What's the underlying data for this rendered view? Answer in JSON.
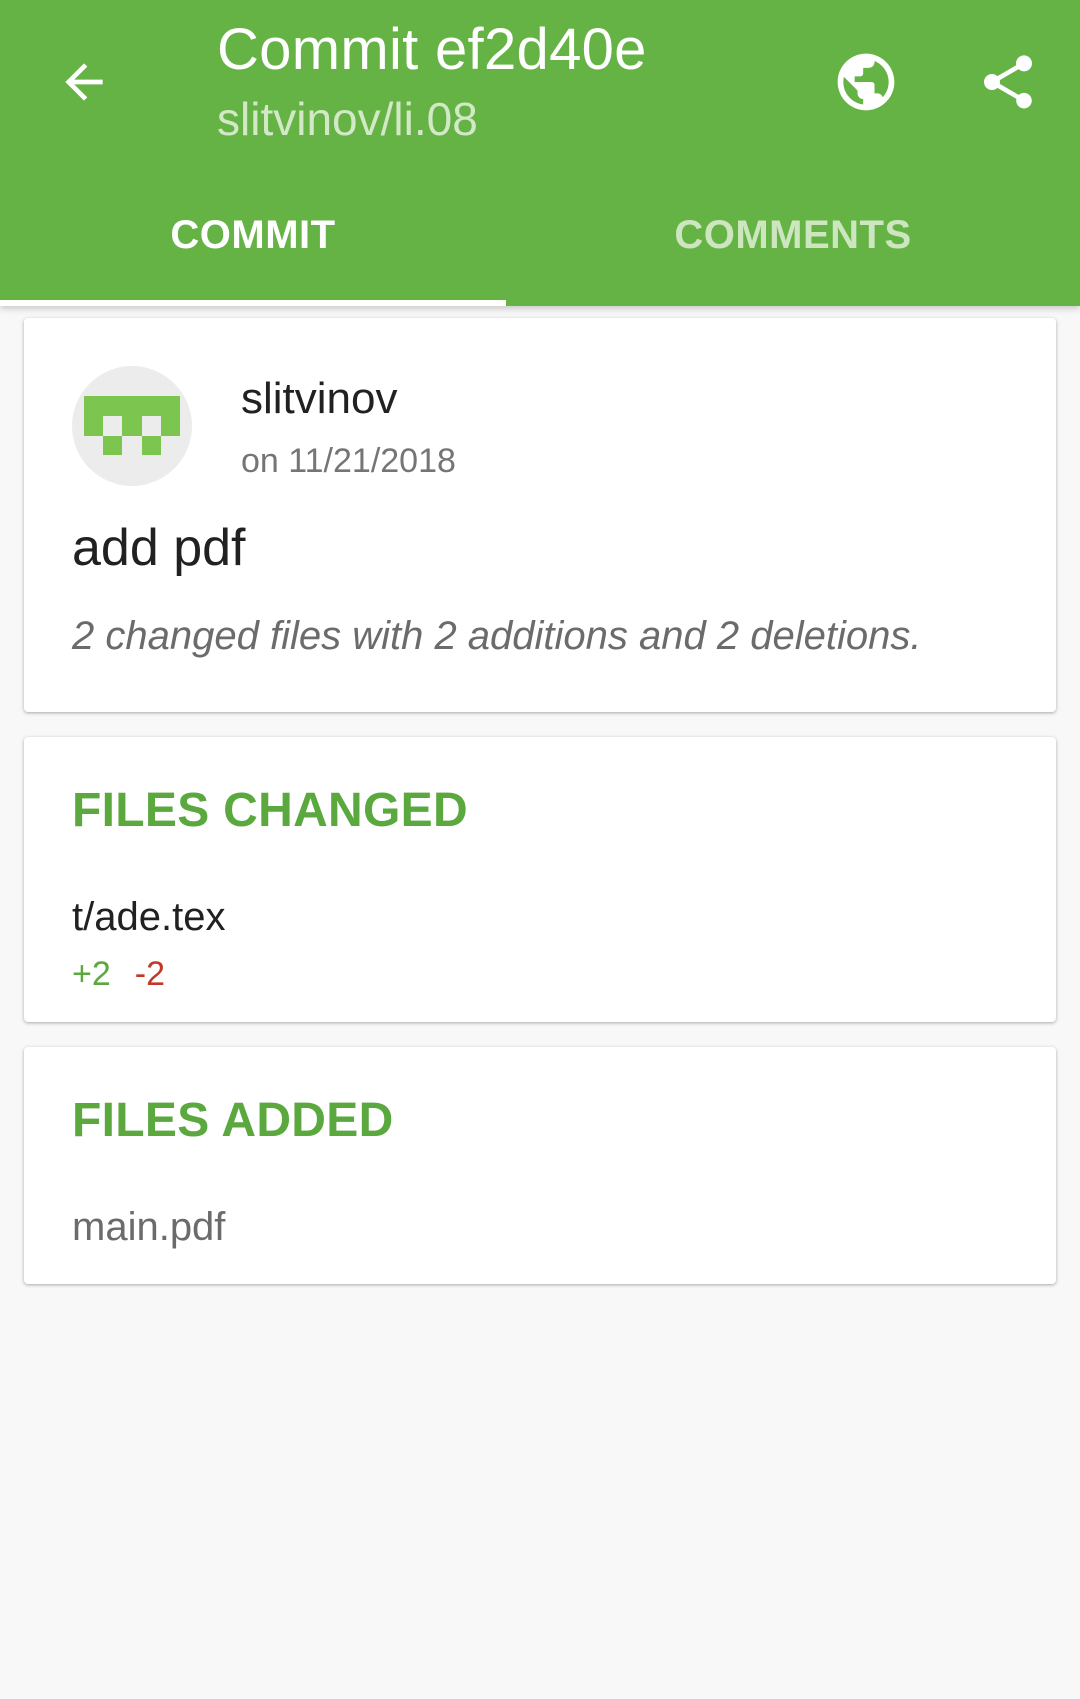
{
  "appbar": {
    "title": "Commit ef2d40e",
    "subtitle": "slitvinov/li.08",
    "background_color": "#65b345",
    "icons": [
      "arrow-back-icon",
      "globe-icon",
      "share-icon"
    ]
  },
  "tabs": [
    {
      "label": "COMMIT",
      "selected": true
    },
    {
      "label": "COMMENTS",
      "selected": false
    }
  ],
  "commit": {
    "author": "slitvinov",
    "date": "on 11/21/2018",
    "message": "add pdf",
    "summary": "2 changed files with 2 additions and 2 deletions."
  },
  "files_changed": {
    "title": "FILES CHANGED",
    "files": [
      {
        "name": "t/ade.tex",
        "additions": "+2",
        "deletions": "-2"
      }
    ]
  },
  "files_added": {
    "title": "FILES ADDED",
    "files": [
      {
        "name": "main.pdf"
      }
    ]
  },
  "colors": {
    "accent": "#65b345",
    "section_title": "#5aa83e",
    "additions": "#5aa83e",
    "deletions": "#c0392b"
  }
}
